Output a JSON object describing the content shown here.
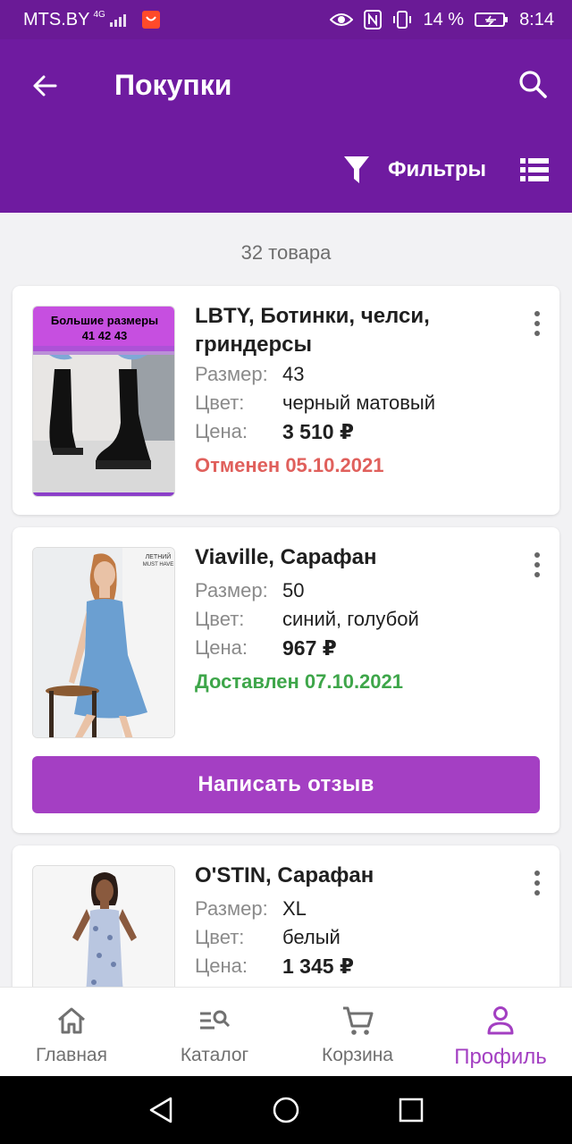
{
  "statusbar": {
    "carrier": "MTS.BY",
    "network": "4G",
    "battery": "14 %",
    "time": "8:14"
  },
  "appbar": {
    "title": "Покупки",
    "filters_label": "Фильтры"
  },
  "list": {
    "count": "32 товара"
  },
  "labels": {
    "size": "Размер:",
    "color": "Цвет:",
    "price": "Цена:"
  },
  "items": [
    {
      "name": "LBTY, Ботинки, челси, гриндерсы",
      "size": "43",
      "color": "черный матовый",
      "price": "3 510 ₽",
      "status": "Отменен 05.10.2021",
      "status_color": "#e0605c",
      "banner_title": "Большие размеры",
      "banner_sizes": "41   42   43"
    },
    {
      "name": "Viaville, Сарафан",
      "size": "50",
      "color": "синий, голубой",
      "price": "967 ₽",
      "status": "Доставлен 07.10.2021",
      "status_color": "#3ea64a",
      "tag_line1": "ЛЕТНИЙ",
      "tag_line2": "MUST HAVE",
      "button": "Написать отзыв"
    },
    {
      "name": "O'STIN, Сарафан",
      "size": "XL",
      "color": "белый",
      "price": "1 345 ₽"
    }
  ],
  "bottom_nav": [
    {
      "label": "Главная",
      "icon": "home-icon"
    },
    {
      "label": "Каталог",
      "icon": "catalog-search-icon"
    },
    {
      "label": "Корзина",
      "icon": "cart-icon"
    },
    {
      "label": "Профиль",
      "icon": "profile-icon",
      "active": true
    }
  ],
  "colors": {
    "appbar": "#6f1ba0",
    "accent": "#a43fc3"
  }
}
